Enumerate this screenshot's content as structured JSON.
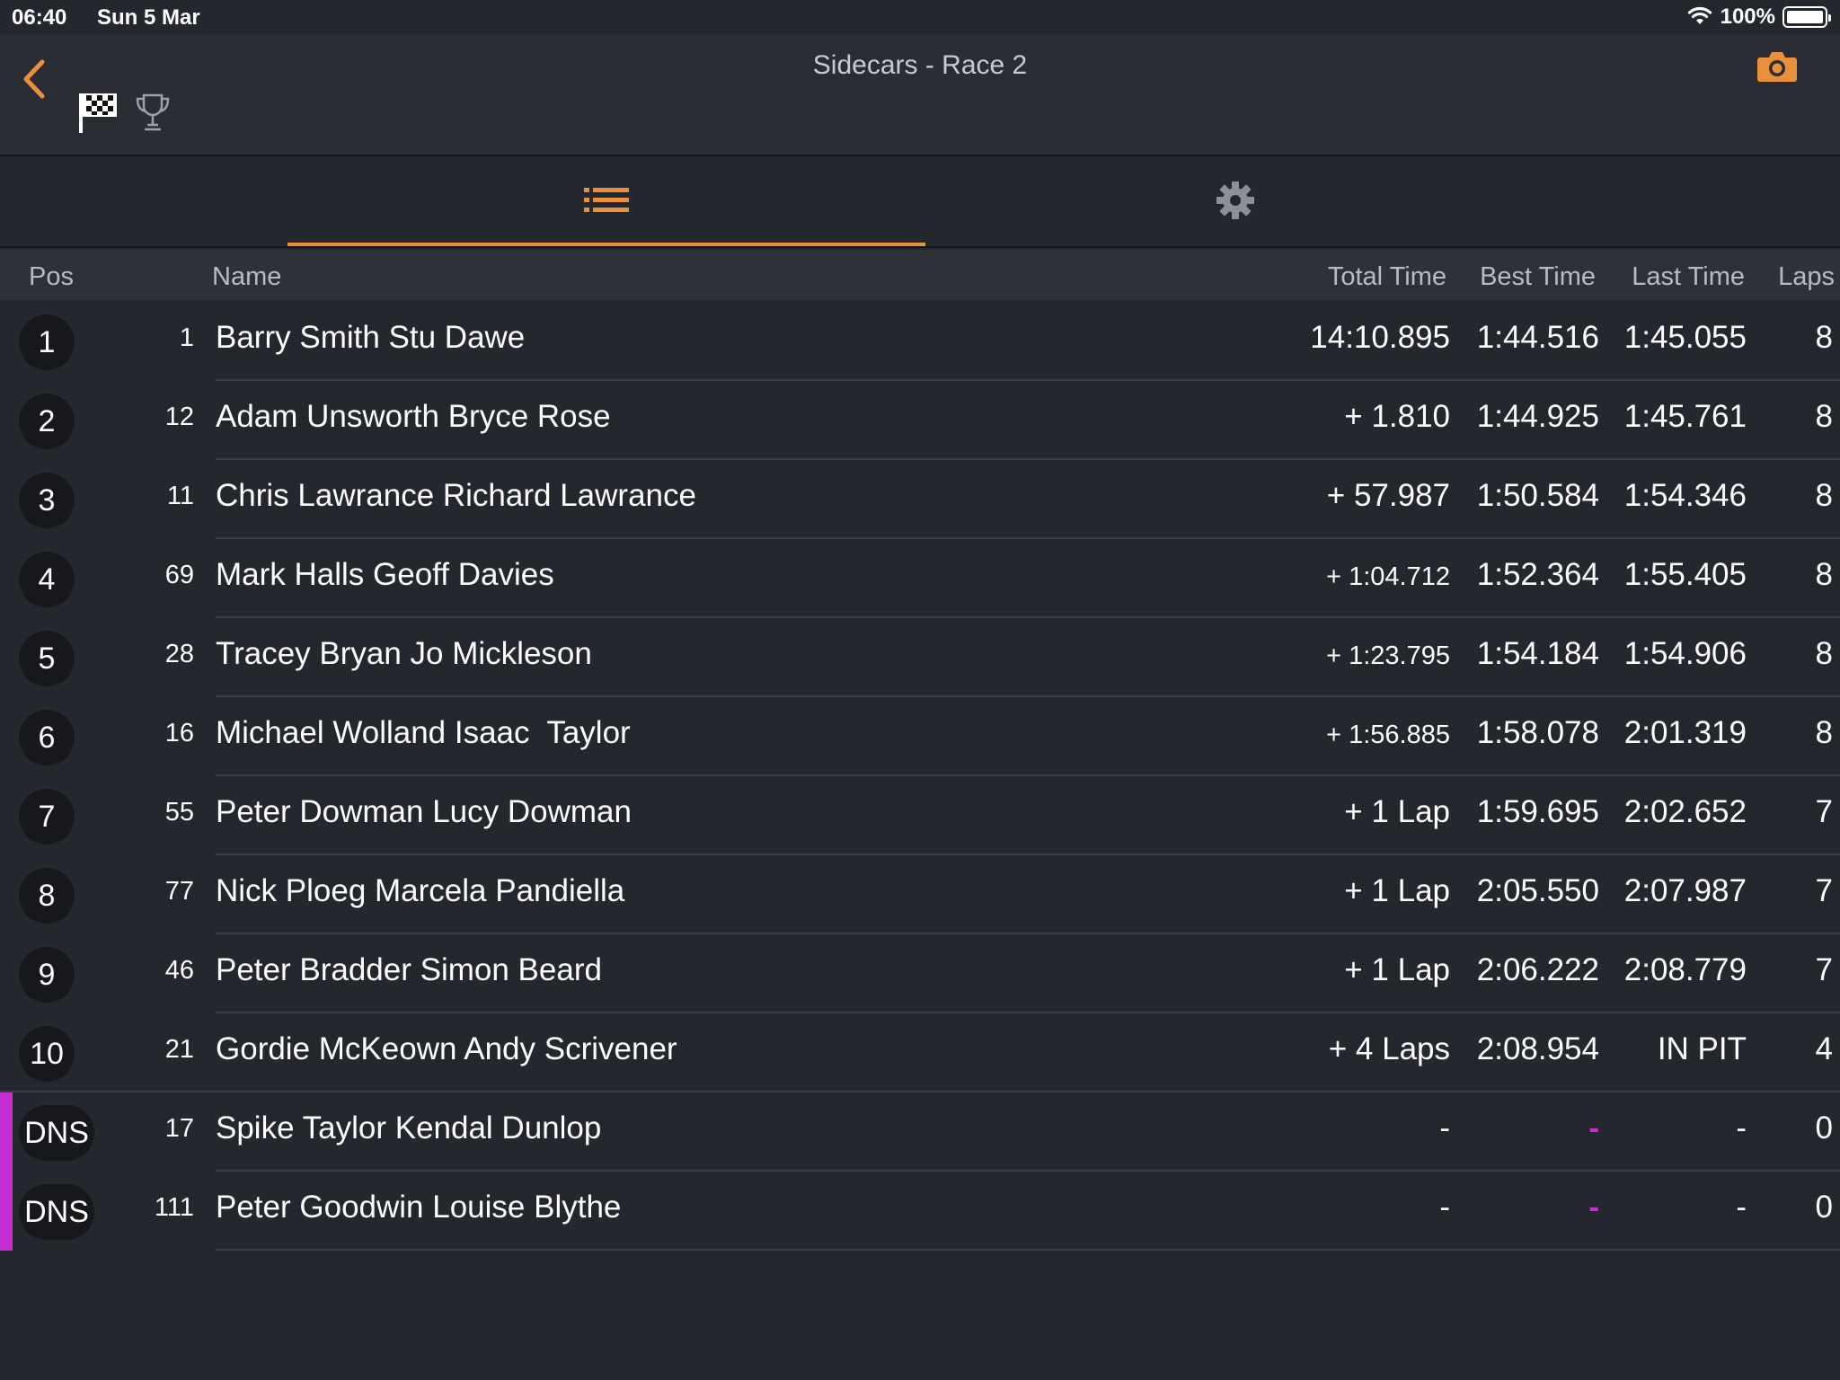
{
  "status_bar": {
    "time": "06:40",
    "date": "Sun 5 Mar",
    "battery": "100%"
  },
  "header": {
    "title": "Sidecars - Race 2"
  },
  "colors": {
    "accent": "#e8913a",
    "dns": "#c62fd3",
    "background": "#25272e"
  },
  "icons": [
    "back-chevron-icon",
    "checkered-flag-icon",
    "trophy-icon",
    "camera-icon",
    "list-icon",
    "gear-icon",
    "wifi-icon",
    "battery-icon"
  ],
  "table": {
    "headers": {
      "pos": "Pos",
      "name": "Name",
      "total": "Total Time",
      "best": "Best Time",
      "last": "Last Time",
      "laps": "Laps"
    },
    "rows": [
      {
        "pos": "1",
        "num": "1",
        "name": "Barry Smith Stu Dawe",
        "total": "14:10.895",
        "best": "1:44.516",
        "last": "1:45.055",
        "laps": "8"
      },
      {
        "pos": "2",
        "num": "12",
        "name": "Adam Unsworth Bryce Rose",
        "total": "+ 1.810",
        "best": "1:44.925",
        "last": "1:45.761",
        "laps": "8"
      },
      {
        "pos": "3",
        "num": "11",
        "name": "Chris Lawrance Richard Lawrance",
        "total": "+ 57.987",
        "best": "1:50.584",
        "last": "1:54.346",
        "laps": "8"
      },
      {
        "pos": "4",
        "num": "69",
        "name": "Mark Halls Geoff Davies",
        "total": "+ 1:04.712",
        "best": "1:52.364",
        "last": "1:55.405",
        "laps": "8"
      },
      {
        "pos": "5",
        "num": "28",
        "name": "Tracey Bryan Jo Mickleson",
        "total": "+ 1:23.795",
        "best": "1:54.184",
        "last": "1:54.906",
        "laps": "8"
      },
      {
        "pos": "6",
        "num": "16",
        "name": "Michael Wolland Isaac  Taylor",
        "total": "+ 1:56.885",
        "best": "1:58.078",
        "last": "2:01.319",
        "laps": "8"
      },
      {
        "pos": "7",
        "num": "55",
        "name": "Peter Dowman Lucy Dowman",
        "total": "+ 1 Lap",
        "best": "1:59.695",
        "last": "2:02.652",
        "laps": "7"
      },
      {
        "pos": "8",
        "num": "77",
        "name": "Nick Ploeg Marcela Pandiella",
        "total": "+ 1 Lap",
        "best": "2:05.550",
        "last": "2:07.987",
        "laps": "7"
      },
      {
        "pos": "9",
        "num": "46",
        "name": "Peter Bradder Simon Beard",
        "total": "+ 1 Lap",
        "best": "2:06.222",
        "last": "2:08.779",
        "laps": "7"
      },
      {
        "pos": "10",
        "num": "21",
        "name": "Gordie McKeown Andy Scrivener",
        "total": "+ 4 Laps",
        "best": "2:08.954",
        "last": "IN PIT",
        "laps": "4"
      },
      {
        "pos": "DNS",
        "num": "17",
        "name": "Spike Taylor Kendal Dunlop",
        "total": "-",
        "best": "-",
        "last": "-",
        "laps": "0"
      },
      {
        "pos": "DNS",
        "num": "111",
        "name": "Peter Goodwin Louise Blythe",
        "total": "-",
        "best": "-",
        "last": "-",
        "laps": "0"
      }
    ]
  }
}
